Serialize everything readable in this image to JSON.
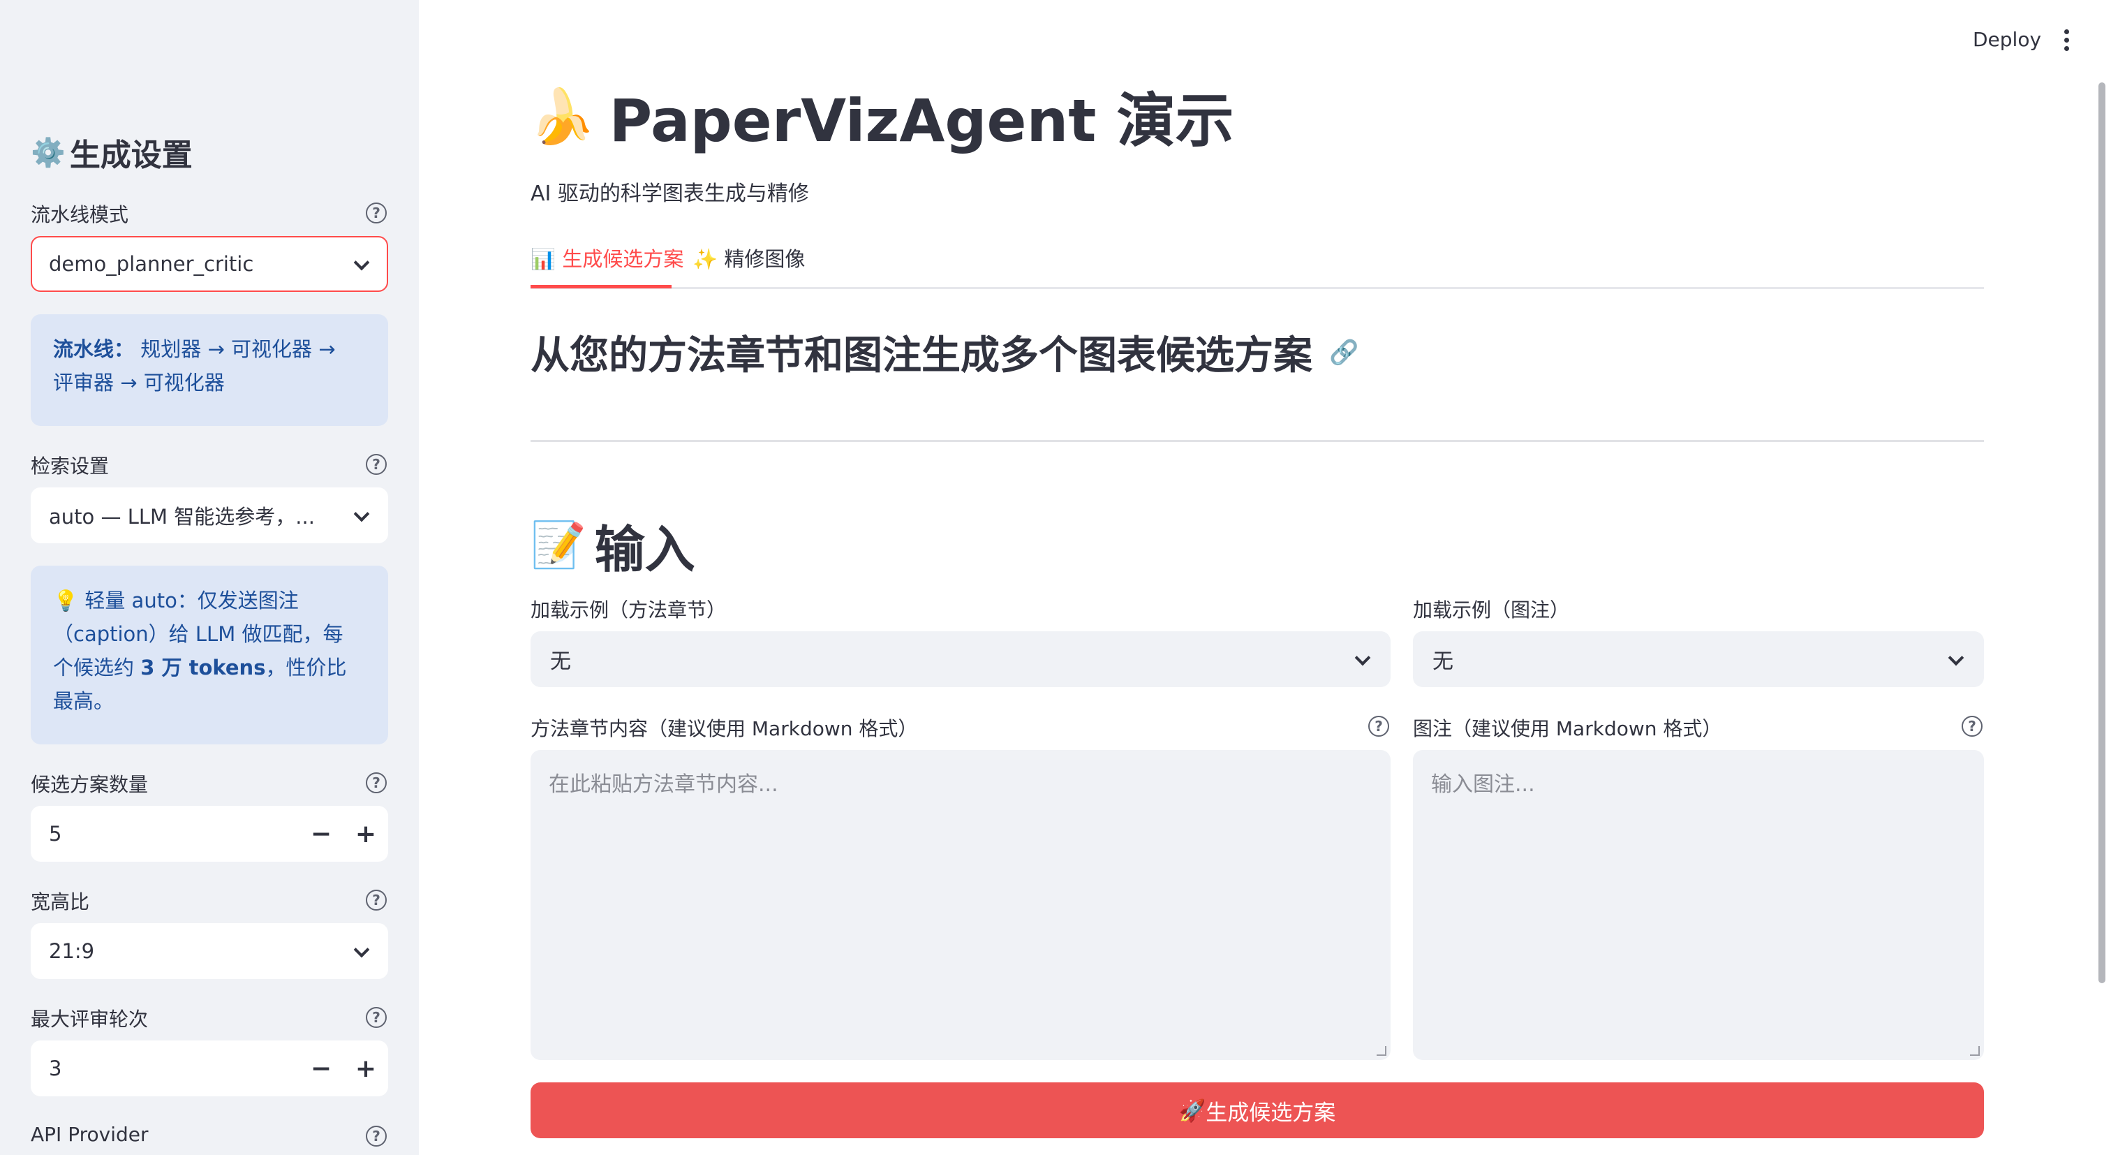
{
  "sidebar": {
    "title_icon": "gear-icon",
    "title": "生成设置",
    "pipeline_mode": {
      "label": "流水线模式",
      "value": "demo_planner_critic"
    },
    "pipeline_info": {
      "prefix": "流水线：",
      "text_line1": " 规划器 → 可视化器 →",
      "text_line2": "评审器 → 可视化器"
    },
    "retrieval": {
      "label": "检索设置",
      "value": "auto — LLM 智能选参考，..."
    },
    "retrieval_info": {
      "icon": "lightbulb-icon",
      "line1": "轻量 auto：仅发送图注",
      "line2": "（caption）给 LLM 做匹配，每",
      "line3_a": "个候选约 ",
      "line3_b": "3 万 tokens",
      "line3_c": "，性价比",
      "line4": "最高。"
    },
    "num_candidates": {
      "label": "候选方案数量",
      "value": "5"
    },
    "aspect_ratio": {
      "label": "宽高比",
      "value": "21:9"
    },
    "max_rounds": {
      "label": "最大评审轮次",
      "value": "3"
    },
    "api_provider": {
      "label": "API Provider"
    },
    "stepper_minus": "−",
    "stepper_plus": "+"
  },
  "header": {
    "deploy_label": "Deploy"
  },
  "main": {
    "title_icon": "banana-icon",
    "title": "PaperVizAgent 演示",
    "subtitle": "AI 驱动的科学图表生成与精修",
    "tabs": [
      {
        "icon": "📊",
        "label": "生成候选方案"
      },
      {
        "icon": "✨",
        "label": "精修图像"
      }
    ],
    "section_heading": "从您的方法章节和图注生成多个图表候选方案",
    "input_heading_icon": "memo-icon",
    "input_heading": "输入",
    "example_method": {
      "label": "加载示例（方法章节）",
      "value": "无"
    },
    "example_caption": {
      "label": "加载示例（图注）",
      "value": "无"
    },
    "method_content": {
      "label": "方法章节内容（建议使用 Markdown 格式）",
      "placeholder": "在此粘贴方法章节内容..."
    },
    "caption_content": {
      "label": "图注（建议使用 Markdown 格式）",
      "placeholder": "输入图注..."
    },
    "generate_button": {
      "icon": "🚀",
      "label": "生成候选方案"
    }
  },
  "colors": {
    "accent": "#ff4b4b",
    "primary_button": "#ed5454",
    "sidebar_bg": "#f0f2f6",
    "info_bg": "#dde6f6",
    "info_text": "#1d4f9a"
  }
}
